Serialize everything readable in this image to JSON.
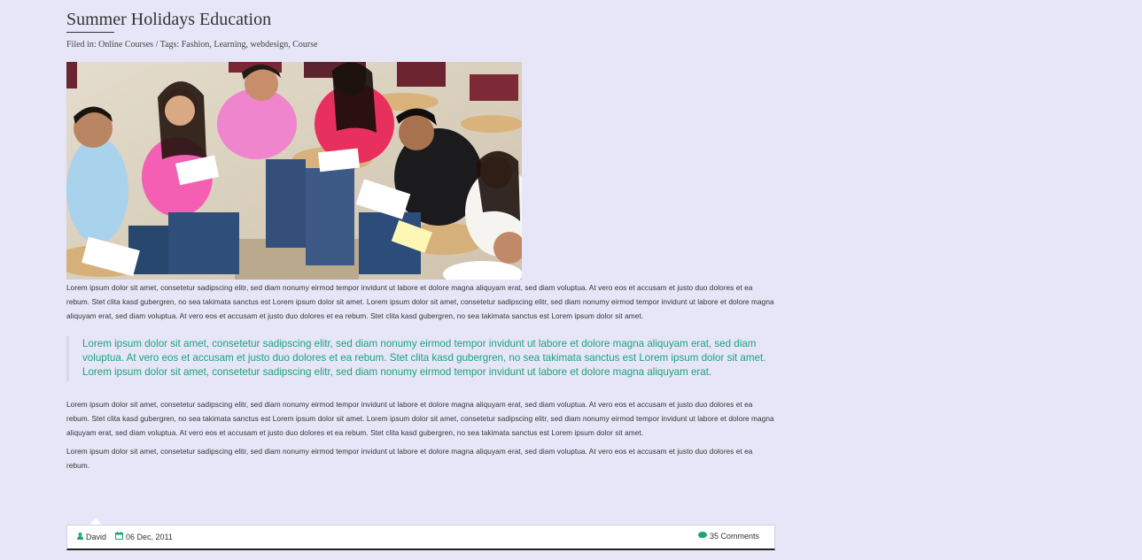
{
  "post": {
    "title": "Summer Holidays Education",
    "meta": {
      "filed_in_label": "Filed in:",
      "category": "Online Courses",
      "separator": "/",
      "tags_label": "Tags:",
      "tags": "Fashion, Learning, webdesign, Course"
    },
    "image_alt": "Students studying together in a classroom",
    "paragraph1": "Lorem ipsum dolor sit amet, consetetur sadipscing elitr, sed diam nonumy eirmod tempor invidunt ut labore et dolore magna aliquyam erat, sed diam voluptua. At vero eos et accusam et justo duo dolores et ea rebum. Stet clita kasd gubergren, no sea takimata sanctus est Lorem ipsum dolor sit amet. Lorem ipsum dolor sit amet, consetetur sadipscing elitr, sed diam nonumy eirmod tempor invidunt ut labore et dolore magna aliquyam erat, sed diam voluptua. At vero eos et accusam et justo duo dolores et ea rebum. Stet clita kasd gubergren, no sea takimata sanctus est Lorem ipsum dolor sit amet.",
    "quote": "Lorem ipsum dolor sit amet, consetetur sadipscing elitr, sed diam nonumy eirmod tempor invidunt ut labore et dolore magna aliquyam erat, sed diam voluptua. At vero eos et accusam et justo duo dolores et ea rebum. Stet clita kasd gubergren, no sea takimata sanctus est Lorem ipsum dolor sit amet. Lorem ipsum dolor sit amet, consetetur sadipscing elitr, sed diam nonumy eirmod tempor invidunt ut labore et dolore magna aliquyam erat.",
    "paragraph2": "Lorem ipsum dolor sit amet, consetetur sadipscing elitr, sed diam nonumy eirmod tempor invidunt ut labore et dolore magna aliquyam erat, sed diam voluptua. At vero eos et accusam et justo duo dolores et ea rebum. Stet clita kasd gubergren, no sea takimata sanctus est Lorem ipsum dolor sit amet. Lorem ipsum dolor sit amet, consetetur sadipscing elitr, sed diam nonumy eirmod tempor invidunt ut labore et dolore magna aliquyam erat, sed diam voluptua. At vero eos et accusam et justo duo dolores et ea rebum. Stet clita kasd gubergren, no sea takimata sanctus est Lorem ipsum dolor sit amet.",
    "paragraph3": "Lorem ipsum dolor sit amet, consetetur sadipscing elitr, sed diam nonumy eirmod tempor invidunt ut labore et dolore magna aliquyam erat, sed diam voluptua. At vero eos et accusam et justo duo dolores et ea rebum."
  },
  "footer": {
    "author": "David",
    "author_icon": "user-icon",
    "date": "06 Dec, 2011",
    "date_icon": "calendar-icon",
    "comments": "35 Comments",
    "comments_icon": "comment-icon"
  },
  "colors": {
    "background": "#e6e6f8",
    "accent": "#19a47a",
    "text": "#333333"
  }
}
